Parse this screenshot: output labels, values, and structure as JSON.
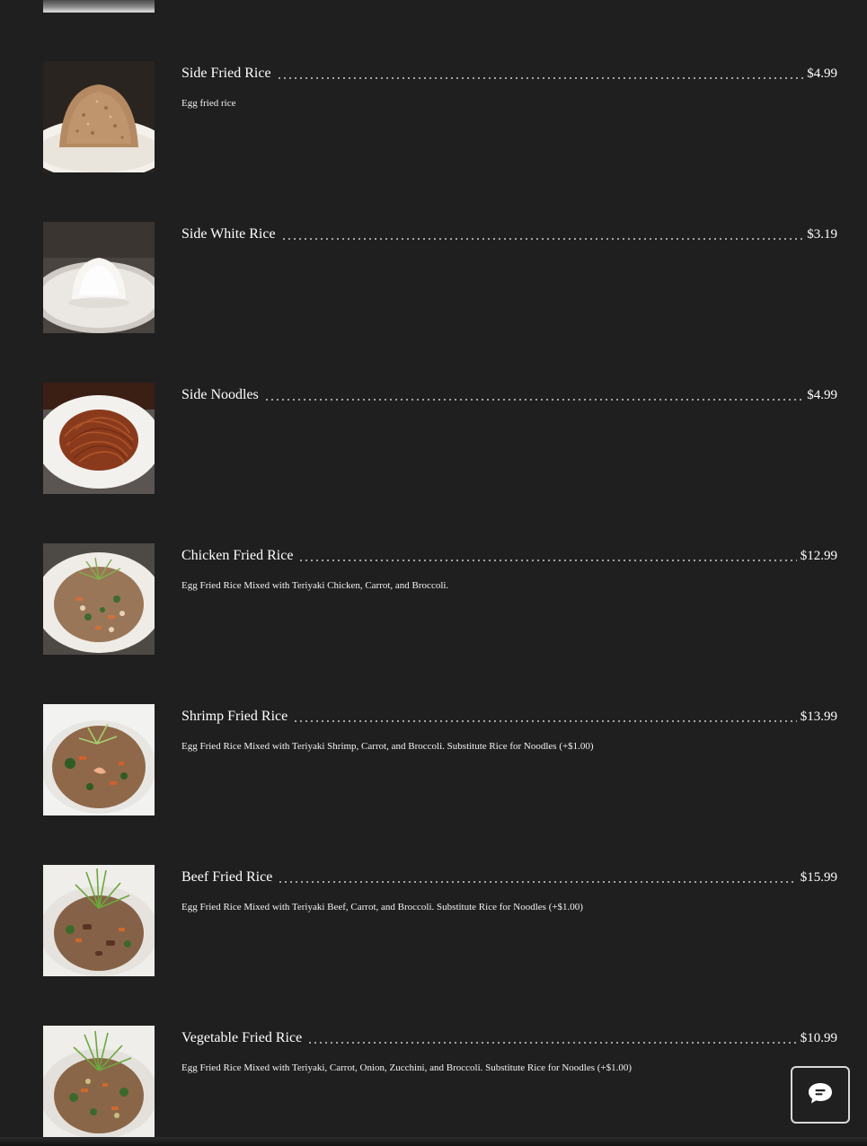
{
  "menu": {
    "items": [
      {
        "name": "Side Fried Rice",
        "price": "$4.99",
        "description": "Egg fried rice",
        "image_icon": "fried-rice-dome-photo"
      },
      {
        "name": "Side White Rice",
        "price": "$3.19",
        "description": "",
        "image_icon": "white-rice-dome-photo"
      },
      {
        "name": "Side Noodles",
        "price": "$4.99",
        "description": "",
        "image_icon": "noodles-plate-photo"
      },
      {
        "name": "Chicken Fried Rice",
        "price": "$12.99",
        "description": "Egg Fried Rice Mixed with Teriyaki Chicken, Carrot, and Broccoli.",
        "image_icon": "chicken-fried-rice-photo"
      },
      {
        "name": "Shrimp Fried Rice",
        "price": "$13.99",
        "description": "Egg Fried Rice Mixed with Teriyaki Shrimp, Carrot, and Broccoli. Substitute Rice for Noodles (+$1.00)",
        "image_icon": "shrimp-fried-rice-photo"
      },
      {
        "name": "Beef Fried Rice",
        "price": "$15.99",
        "description": "Egg Fried Rice Mixed with Teriyaki Beef, Carrot, and Broccoli. Substitute Rice for Noodles (+$1.00)",
        "image_icon": "beef-fried-rice-photo"
      },
      {
        "name": "Vegetable Fried Rice",
        "price": "$10.99",
        "description": "Egg Fried Rice Mixed with Teriyaki, Carrot, Onion, Zucchini, and Broccoli. Substitute Rice for Noodles (+$1.00)",
        "image_icon": "vegetable-fried-rice-photo"
      }
    ]
  },
  "chat": {
    "icon": "chat-bubble-icon"
  },
  "colors": {
    "background": "#1f1f1f",
    "text": "#ffffff",
    "leader_dots": "#cfcfcf"
  }
}
